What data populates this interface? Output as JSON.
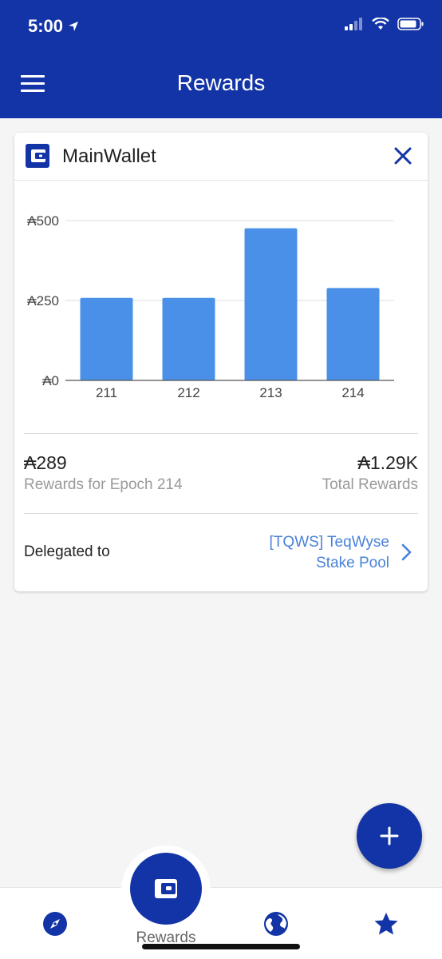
{
  "status_bar": {
    "time": "5:00"
  },
  "app_bar": {
    "title": "Rewards"
  },
  "wallet": {
    "name": "MainWallet"
  },
  "chart_data": {
    "type": "bar",
    "categories": [
      "211",
      "212",
      "213",
      "214"
    ],
    "values": [
      258,
      258,
      476,
      289
    ],
    "y_ticks": [
      "₳0",
      "₳250",
      "₳500"
    ],
    "y_tick_values": [
      0,
      250,
      500
    ],
    "ylim": [
      0,
      500
    ],
    "bar_color": "#4a90e8",
    "grid": true
  },
  "summary": {
    "epoch_amount": "₳289",
    "epoch_label": "Rewards for Epoch 214",
    "total_amount": "₳1.29K",
    "total_label": "Total Rewards"
  },
  "delegation": {
    "label": "Delegated to",
    "pool_line1": "[TQWS] TeqWyse",
    "pool_line2": "Stake Pool"
  },
  "bottom_nav": {
    "center_label": "Rewards"
  },
  "colors": {
    "primary": "#1334a6",
    "link": "#4a82d9",
    "bar": "#4a90e8"
  },
  "icons": [
    "menu-icon",
    "wallet-icon",
    "close-icon",
    "chevron-right-icon",
    "plus-icon",
    "compass-icon",
    "globe-icon",
    "star-icon"
  ]
}
